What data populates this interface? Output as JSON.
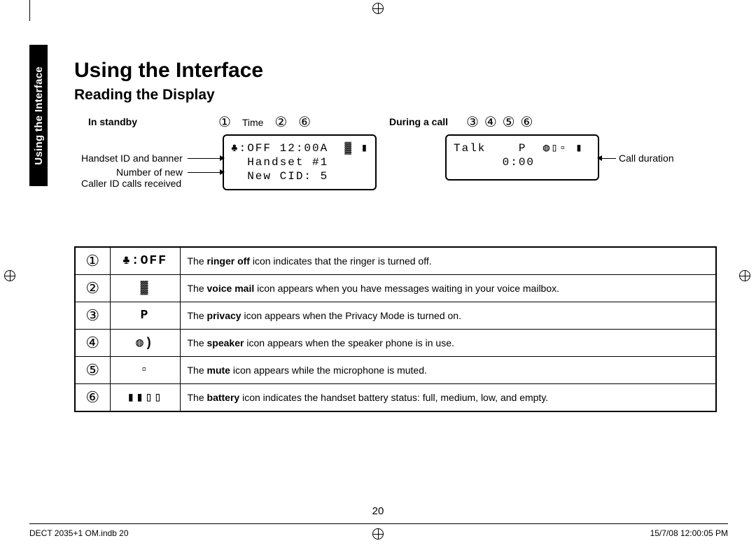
{
  "tab": "Using the Interface",
  "h1": "Using the Interface",
  "h2": "Reading the Display",
  "standby_label": "In standby",
  "during_label": "During a call",
  "markers_standby": {
    "a": "①",
    "time": "Time",
    "b": "②",
    "c": "⑥"
  },
  "markers_during": {
    "a": "③",
    "b": "④",
    "c": "⑤",
    "d": "⑥"
  },
  "lcd_standby": {
    "line1": "♣:OFF 12:00A  ▓ ▮",
    "line2": "  Handset #1",
    "line3": "  New CID: 5"
  },
  "lcd_call": {
    "line1": "Talk    P  ◍▯▫ ▮",
    "line2": "      0:00"
  },
  "annot": {
    "handset_id": "Handset ID and banner",
    "new_cid_1": "Number of new",
    "new_cid_2": "Caller ID calls received",
    "call_dur": "Call duration"
  },
  "rows": [
    {
      "num": "①",
      "icon": "♣:OFF",
      "bold": "ringer off",
      "desc_before": "The ",
      "desc_after": " icon indicates that the ringer is turned off."
    },
    {
      "num": "②",
      "icon": "▓",
      "bold": "voice mail",
      "desc_before": "The ",
      "desc_after": " icon appears when you have messages waiting in your voice mailbox."
    },
    {
      "num": "③",
      "icon": "P",
      "bold": "privacy",
      "desc_before": "The ",
      "desc_after": " icon appears when the Privacy Mode is turned on."
    },
    {
      "num": "④",
      "icon": "◍)",
      "bold": "speaker",
      "desc_before": "The ",
      "desc_after": " icon appears when the speaker phone is in use."
    },
    {
      "num": "⑤",
      "icon": "▫",
      "bold": "mute",
      "desc_before": "The ",
      "desc_after": " icon appears while the microphone is muted."
    },
    {
      "num": "⑥",
      "icon": "▮▮▯▯",
      "bold": "battery",
      "desc_before": "The ",
      "desc_after": " icon indicates the handset battery status: full, medium, low, and empty."
    }
  ],
  "page_num": "20",
  "footer_left": "DECT 2035+1 OM.indb   20",
  "footer_right": "15/7/08   12:00:05 PM"
}
